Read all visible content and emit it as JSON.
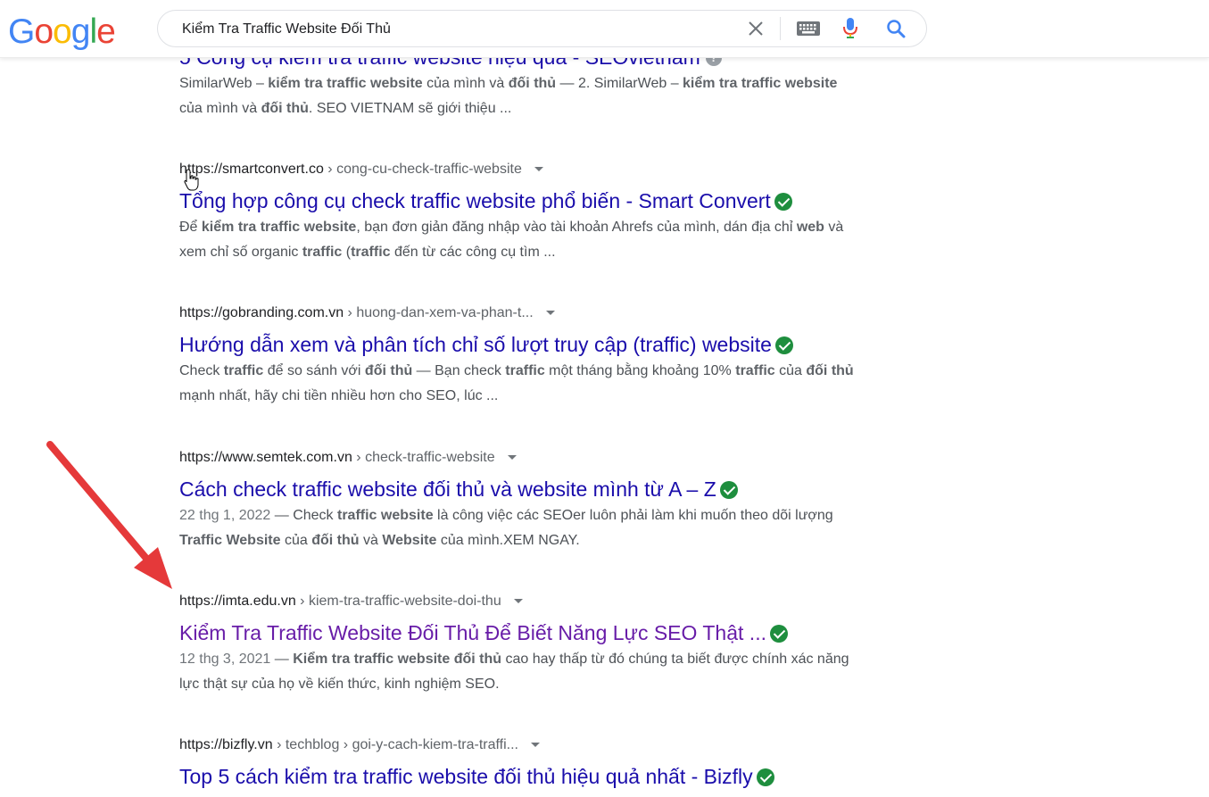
{
  "logo": {
    "letters": [
      "G",
      "o",
      "o",
      "g",
      "l",
      "e"
    ],
    "colors": [
      "#4285f4",
      "#ea4335",
      "#fbbc05",
      "#4285f4",
      "#34a853",
      "#ea4335"
    ]
  },
  "search": {
    "query": "Kiểm Tra Traffic Website Đối Thủ"
  },
  "colors": {
    "link": "#1a0dab",
    "visited": "#681da8",
    "verified": "#1e8e3e",
    "arrow": "#e5393a"
  },
  "results": [
    {
      "title": "5 Công cụ kiểm tra traffic website hiệu quả - SEOvietnam",
      "snippet": [
        {
          "t": "SimilarWeb – "
        },
        {
          "b": "kiểm tra traffic website"
        },
        {
          "t": " của mình và "
        },
        {
          "b": "đối thủ"
        },
        {
          "t": " — 2. SimilarWeb – "
        },
        {
          "b": "kiểm tra traffic website"
        },
        {
          "t": " của mình và "
        },
        {
          "b": "đối thủ"
        },
        {
          "t": ". SEO VIETNAM sẽ giới thiệu ..."
        }
      ]
    },
    {
      "domain": "https://smartconvert.co",
      "path": " › cong-cu-check-traffic-website",
      "title": "Tổng hợp công cụ check traffic website phổ biến - Smart Convert",
      "verified": true,
      "snippet": [
        {
          "t": "Để "
        },
        {
          "b": "kiểm tra traffic website"
        },
        {
          "t": ", bạn đơn giản đăng nhập vào tài khoản Ahrefs của mình, dán địa chỉ "
        },
        {
          "b": "web"
        },
        {
          "t": " và xem chỉ số organic "
        },
        {
          "b": "traffic"
        },
        {
          "t": " ("
        },
        {
          "b": "traffic"
        },
        {
          "t": " đến từ các công cụ tìm ..."
        }
      ]
    },
    {
      "domain": "https://gobranding.com.vn",
      "path": " › huong-dan-xem-va-phan-t...",
      "title": "Hướng dẫn xem và phân tích chỉ số lượt truy cập (traffic) website",
      "verified": true,
      "snippet": [
        {
          "t": "Check "
        },
        {
          "b": "traffic"
        },
        {
          "t": " để so sánh với "
        },
        {
          "b": "đối thủ"
        },
        {
          "t": " — Bạn check "
        },
        {
          "b": "traffic"
        },
        {
          "t": " một tháng bằng khoảng 10% "
        },
        {
          "b": "traffic"
        },
        {
          "t": " của "
        },
        {
          "b": "đối thủ"
        },
        {
          "t": " mạnh nhất, hãy chi tiền nhiều hơn cho SEO, lúc ..."
        }
      ]
    },
    {
      "domain": "https://www.semtek.com.vn",
      "path": " › check-traffic-website",
      "title": "Cách check traffic website đối thủ và website mình từ A – Z",
      "verified": true,
      "snippet": [
        {
          "d": "22 thg 1, 2022"
        },
        {
          "t": " — Check "
        },
        {
          "b": "traffic website"
        },
        {
          "t": " là công việc các SEOer luôn phải làm khi muốn theo dõi lượng "
        },
        {
          "b": "Traffic Website"
        },
        {
          "t": " của "
        },
        {
          "b": "đối thủ"
        },
        {
          "t": " và "
        },
        {
          "b": "Website"
        },
        {
          "t": " của mình.XEM NGAY."
        }
      ]
    },
    {
      "domain": "https://imta.edu.vn",
      "path": " › kiem-tra-traffic-website-doi-thu",
      "title": "Kiểm Tra Traffic Website Đối Thủ Để Biết Năng Lực SEO Thật ...",
      "verified": true,
      "visited": true,
      "snippet": [
        {
          "d": "12 thg 3, 2021"
        },
        {
          "t": " — "
        },
        {
          "b": "Kiểm tra traffic website đối thủ"
        },
        {
          "t": " cao hay thấp từ đó chúng ta biết được chính xác năng lực thật sự của họ về kiến thức, kinh nghiệm SEO."
        }
      ]
    },
    {
      "domain": "https://bizfly.vn",
      "path": " › techblog › goi-y-cach-kiem-tra-traffi...",
      "title": "Top 5 cách kiểm tra traffic website đối thủ hiệu quả nhất - Bizfly",
      "verified": true
    }
  ]
}
